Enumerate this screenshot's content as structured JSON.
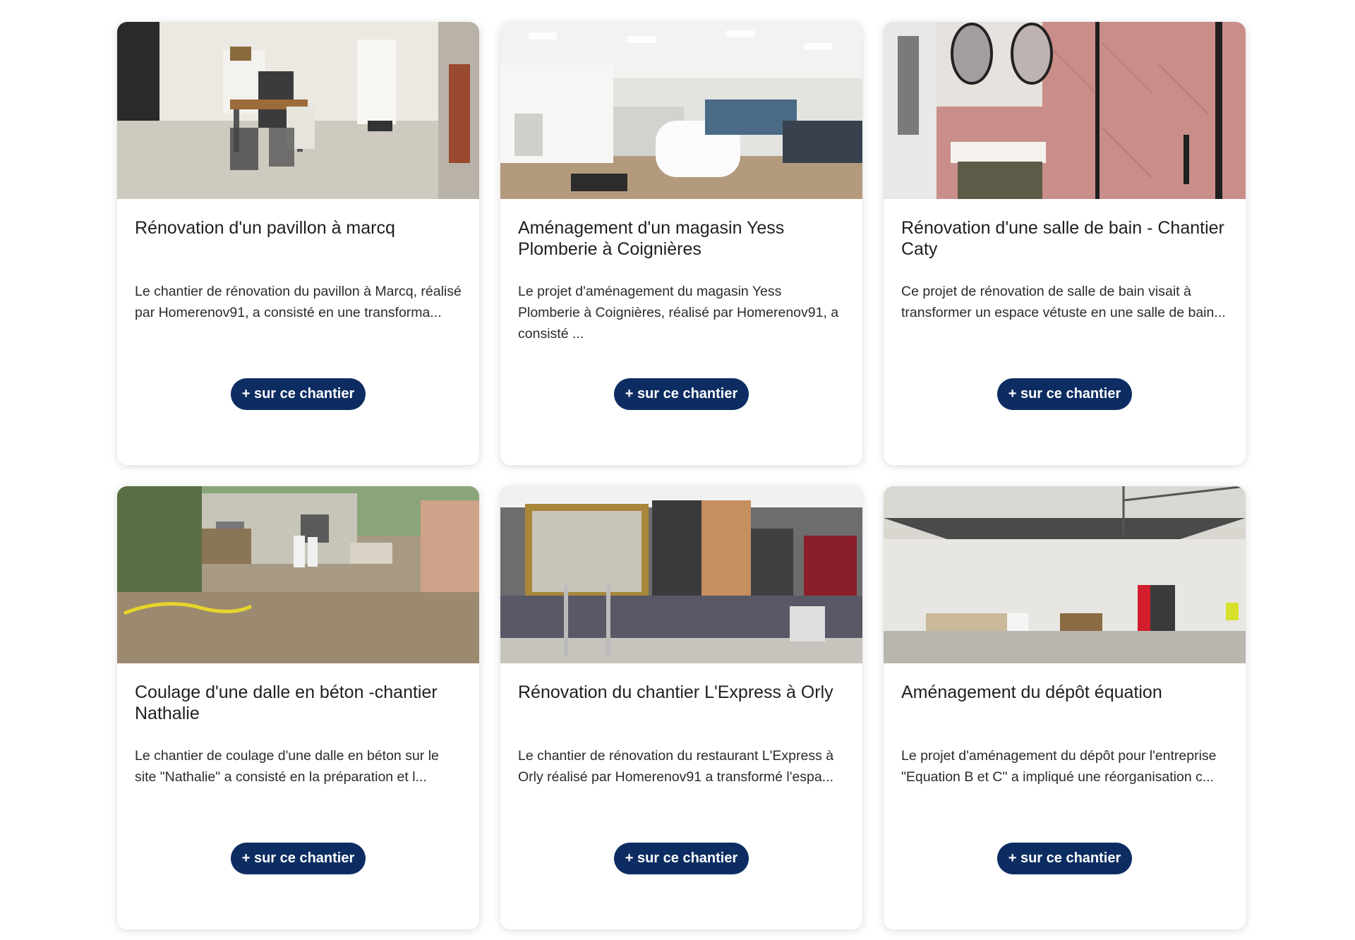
{
  "cards": [
    {
      "title": "Rénovation d'un pavillon à marcq",
      "description": "Le chantier de rénovation du pavillon à Marcq, réalisé par Homerenov91, a consisté en une transforma...",
      "button_label": "+ sur ce chantier",
      "photo_name": "kitchen-photo"
    },
    {
      "title": "Aménagement d'un magasin Yess Plomberie à Coignières",
      "description": "Le projet d'aménagement du magasin Yess Plomberie à Coignières, réalisé par Homerenov91, a consisté ...",
      "button_label": "+ sur ce chantier",
      "photo_name": "showroom-photo"
    },
    {
      "title": "Rénovation d'une salle de bain - Chantier Caty",
      "description": "Ce projet de rénovation de salle de bain visait à transformer un espace vétuste en une salle de bain...",
      "button_label": "+ sur ce chantier",
      "photo_name": "bathroom-photo"
    },
    {
      "title": "Coulage d'une dalle en béton -chantier Nathalie",
      "description": "Le chantier de coulage d'une dalle en béton sur le site \"Nathalie\" a consisté en la préparation et l...",
      "button_label": "+ sur ce chantier",
      "photo_name": "concrete-slab-photo"
    },
    {
      "title": "Rénovation du chantier L'Express à Orly",
      "description": "Le chantier de rénovation du restaurant L'Express à Orly réalisé par Homerenov91 a transformé l'espa...",
      "button_label": "+ sur ce chantier",
      "photo_name": "restaurant-photo"
    },
    {
      "title": "Aménagement du dépôt équation",
      "description": "Le projet d'aménagement du dépôt pour l'entreprise \"Equation B et C\" a impliqué une réorganisation c...",
      "button_label": "+ sur ce chantier",
      "photo_name": "depot-photo"
    }
  ],
  "colors": {
    "button_bg": "#0d2d62",
    "button_text": "#ffffff"
  }
}
